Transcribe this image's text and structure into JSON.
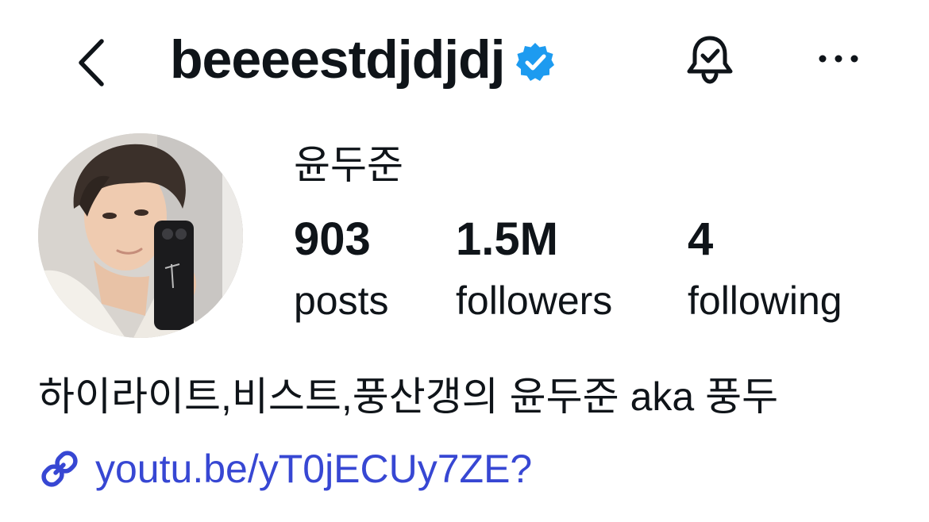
{
  "header": {
    "username": "beeeestdjdjdj",
    "verified": true,
    "back_icon": "chevron-left-icon",
    "notify_icon": "bell-check-icon",
    "more_icon": "ellipsis-icon"
  },
  "profile": {
    "display_name": "윤두준",
    "stats": [
      {
        "value": "903",
        "label": "posts"
      },
      {
        "value": "1.5M",
        "label": "followers"
      },
      {
        "value": "4",
        "label": "following"
      }
    ],
    "bio": "하이라이트,비스트,풍산갱의 윤두준 aka 풍두",
    "link": {
      "icon": "link-icon",
      "text": "youtu.be/yT0jECUy7ZE?"
    }
  },
  "colors": {
    "text": "#0f1419",
    "link": "#3747d3",
    "verified": "#1d9bf0",
    "background": "#ffffff"
  }
}
